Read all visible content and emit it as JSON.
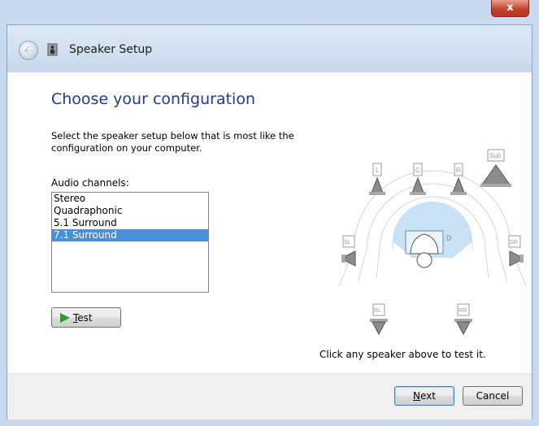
{
  "window": {
    "close_glyph": "x"
  },
  "navbar": {
    "title": "Speaker Setup",
    "back_icon": "back-arrow-icon",
    "app_icon": "speaker-setup-icon"
  },
  "main": {
    "heading": "Choose your configuration",
    "instruction": "Select the speaker setup below that is most like the configuration on your computer.",
    "channels_label": "Audio channels:",
    "channels": [
      {
        "label": "Stereo",
        "selected": false
      },
      {
        "label": "Quadraphonic",
        "selected": false
      },
      {
        "label": "5.1 Surround",
        "selected": false
      },
      {
        "label": "7.1 Surround",
        "selected": true
      }
    ],
    "test_button": {
      "prefix": "",
      "mnemonic": "T",
      "rest": "est",
      "icon": "play-icon"
    },
    "click_hint": "Click any speaker above to test it."
  },
  "speakers": {
    "front_left": "L",
    "center": "C",
    "front_right": "R",
    "subwoofer": "Sub",
    "side_left": "SL",
    "side_right": "SR",
    "rear_left": "RL",
    "rear_right": "RR",
    "listener_label": "D"
  },
  "footer": {
    "next_mnemonic": "N",
    "next_rest": "ext",
    "cancel_label": "Cancel"
  },
  "colors": {
    "heading": "#1f3b8f",
    "selection": "#4a90d9",
    "play": "#2e9a2e"
  }
}
